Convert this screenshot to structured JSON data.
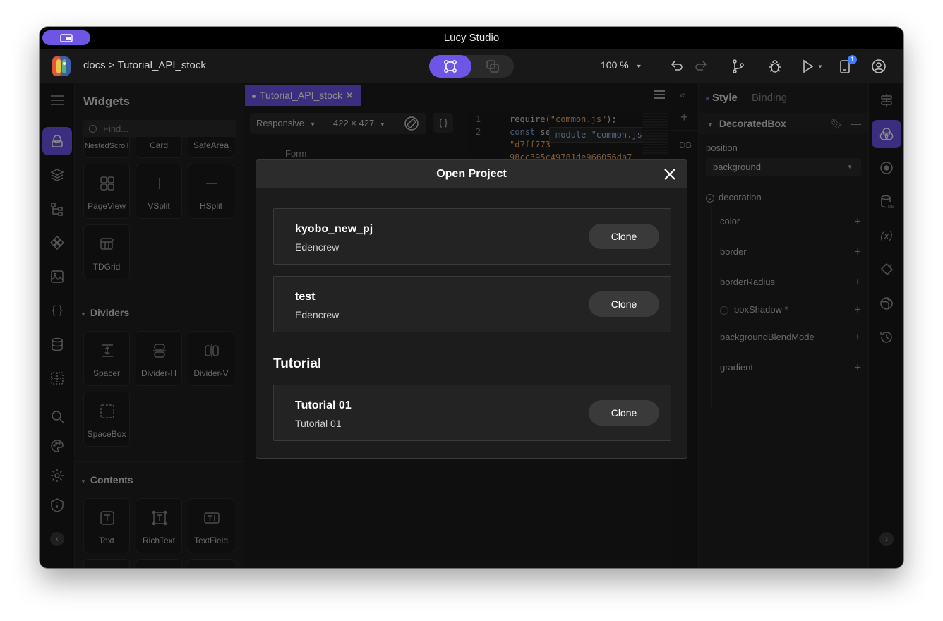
{
  "window": {
    "title": "Lucy Studio"
  },
  "toolbar": {
    "breadcrumb": "docs > Tutorial_API_stock",
    "zoom": "100 %",
    "notification_count": "1"
  },
  "widgets": {
    "title": "Widgets",
    "search_placeholder": "Find...",
    "top_row": [
      "NestedScroll",
      "Card",
      "SafeArea"
    ],
    "layout_items": [
      "PageView",
      "VSplit",
      "HSplit",
      "TDGrid"
    ],
    "dividers_section": "Dividers",
    "divider_items": [
      "Spacer",
      "Divider-H",
      "Divider-V",
      "SpaceBox"
    ],
    "contents_section": "Contents",
    "content_items": [
      "Text",
      "RichText",
      "TextField"
    ]
  },
  "editor": {
    "tab_label": "Tutorial_API_stock",
    "device": "Responsive",
    "size": "422 × 427",
    "curly": "{ }",
    "form_label": "Form",
    "code_line_numbers": [
      "1",
      "2"
    ],
    "code_line1_fn": "require(",
    "code_line1_str": "\"common.js\"",
    "code_line1_end": ");",
    "code_line2_kw": "const",
    "code_line2_rest": " se",
    "code_line3": "\"d7ff773",
    "code_line4": "98cc395c49781de966056da7",
    "hint": "module \"common.js\""
  },
  "mid_strip": {
    "db_label": "DB"
  },
  "properties": {
    "tab_style": "Style",
    "tab_binding": "Binding",
    "widget_name": "DecoratedBox",
    "position_label": "position",
    "position_value": "background",
    "decoration_label": "decoration",
    "decoration_props": [
      "color",
      "border",
      "borderRadius",
      "boxShadow *",
      "backgroundBlendMode",
      "gradient"
    ]
  },
  "modal": {
    "title": "Open Project",
    "projects": [
      {
        "name": "kyobo_new_pj",
        "owner": "Edencrew",
        "action": "Clone"
      },
      {
        "name": "test",
        "owner": "Edencrew",
        "action": "Clone"
      }
    ],
    "section_title": "Tutorial",
    "tutorials": [
      {
        "name": "Tutorial 01",
        "owner": "Tutorial 01",
        "action": "Clone"
      }
    ]
  },
  "colors": {
    "accent": "#6e55e6",
    "background": "#1e1e1e",
    "badge": "#3d7bff"
  }
}
